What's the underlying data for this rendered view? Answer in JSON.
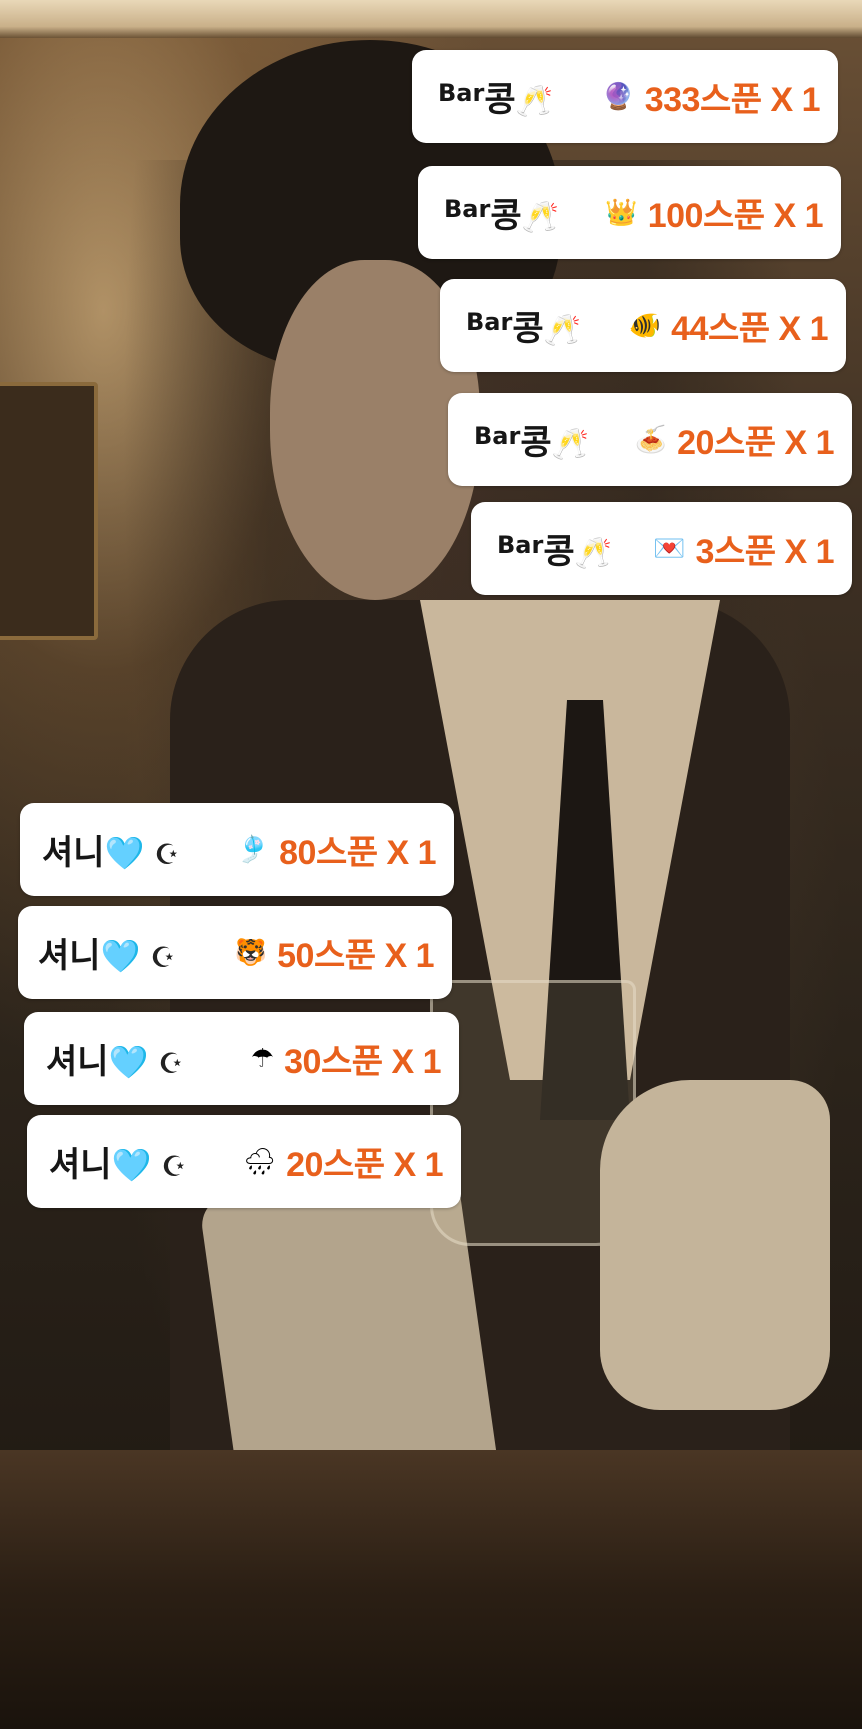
{
  "top_gifts": [
    {
      "prefix": "Bar",
      "name": "콩",
      "icon": "🥂",
      "gift_icon": "🔮",
      "amount": "333스푼 X 1"
    },
    {
      "prefix": "Bar",
      "name": "콩",
      "icon": "🥂",
      "gift_icon": "👑",
      "amount": "100스푼 X 1"
    },
    {
      "prefix": "Bar",
      "name": "콩",
      "icon": "🥂",
      "gift_icon": "🐠",
      "amount": "44스푼 X 1"
    },
    {
      "prefix": "Bar",
      "name": "콩",
      "icon": "🥂",
      "gift_icon": "🍝",
      "amount": "20스푼 X 1"
    },
    {
      "prefix": "Bar",
      "name": "콩",
      "icon": "🥂",
      "gift_icon": "💌",
      "amount": "3스푼 X 1"
    }
  ],
  "bottom_gifts": [
    {
      "name": "셔니",
      "heart": "🩵",
      "crescent": "☪",
      "gift_icon": "🎐",
      "amount": "80스푼 X 1"
    },
    {
      "name": "셔니",
      "heart": "🩵",
      "crescent": "☪",
      "gift_icon": "🐯",
      "amount": "50스푼 X 1"
    },
    {
      "name": "셔니",
      "heart": "🩵",
      "crescent": "☪",
      "gift_icon": "☂",
      "amount": "30스푼 X 1"
    },
    {
      "name": "셔니",
      "heart": "🩵",
      "crescent": "☪",
      "gift_icon": "🌧",
      "amount": "20스푼 X 1"
    }
  ],
  "colors": {
    "amount": "#e8601c",
    "card": "#ffffff",
    "heart": "#38bdf8"
  }
}
